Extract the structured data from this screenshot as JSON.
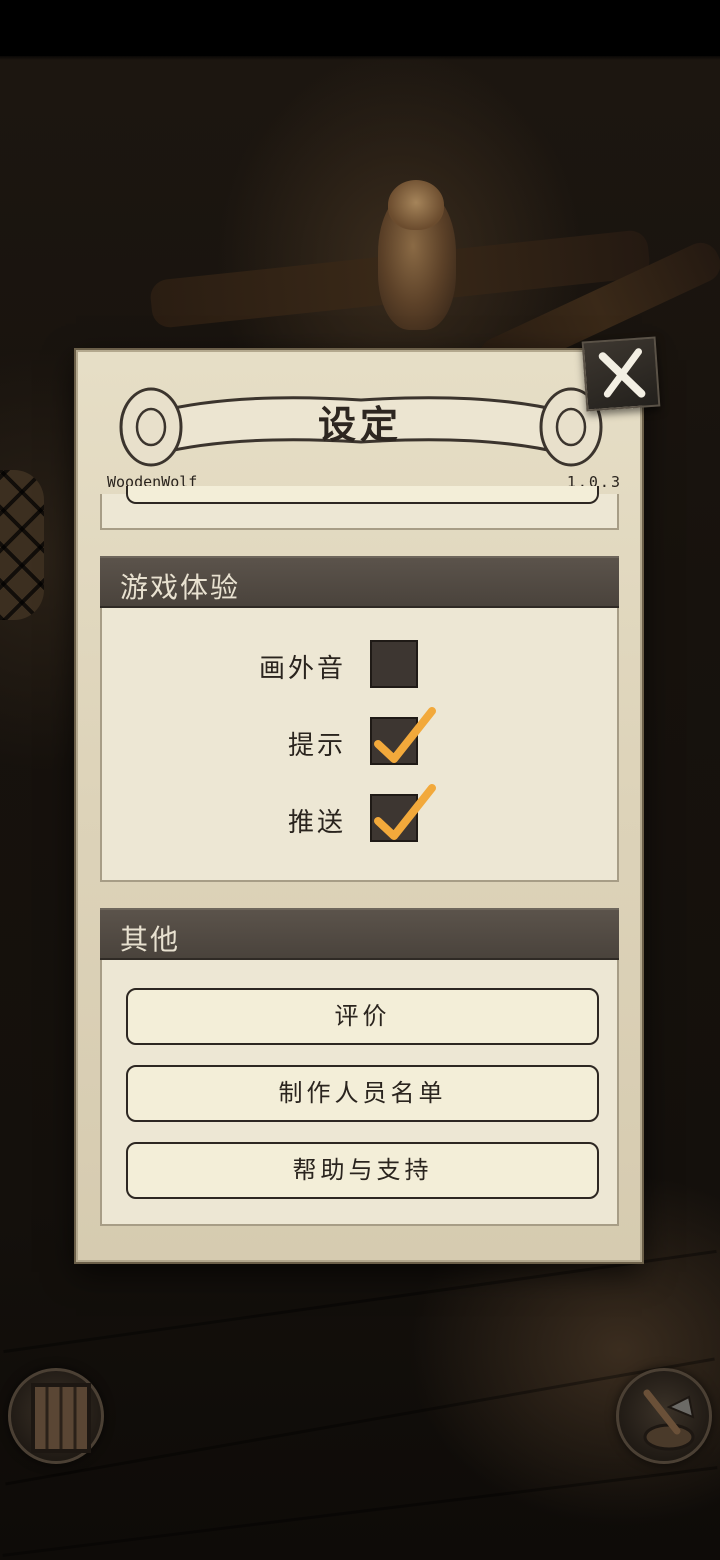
{
  "dialog": {
    "title": "设定",
    "studio": "WoodenWolf",
    "version": "1.0.3"
  },
  "experience": {
    "header": "游戏体验",
    "toggles": [
      {
        "label": "画外音",
        "checked": false
      },
      {
        "label": "提示",
        "checked": true
      },
      {
        "label": "推送",
        "checked": true
      }
    ]
  },
  "other": {
    "header": "其他",
    "buttons": [
      {
        "label": "评价"
      },
      {
        "label": "制作人员名单"
      },
      {
        "label": "帮助与支持"
      }
    ]
  },
  "icons": {
    "close": "close-x-icon",
    "check": "checkmark-icon",
    "door": "door-icon",
    "axe": "axe-icon"
  },
  "colors": {
    "checkmark": "#f2a93b",
    "header_bg": "#4f4841",
    "panel_bg": "#e6dec6"
  }
}
